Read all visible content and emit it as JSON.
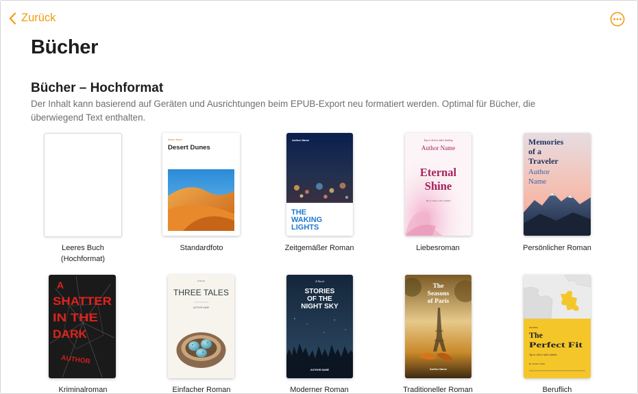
{
  "nav": {
    "back_label": "Zurück",
    "more_icon": "ellipsis-circle-icon",
    "accent": "#f29a12"
  },
  "page_title": "Bücher",
  "section": {
    "title": "Bücher – Hochformat",
    "description": "Der Inhalt kann basierend auf Geräten und Ausrichtungen beim EPUB-Export neu formatiert werden. Optimal für Bücher, die überwiegend Text enthalten."
  },
  "templates": [
    {
      "label": "Leeres Buch\n(Hochformat)",
      "cover": {}
    },
    {
      "label": "Standardfoto",
      "cover": {
        "author": "Author Name",
        "title": "Desert Dunes"
      }
    },
    {
      "label": "Zeitgemäßer Roman",
      "cover": {
        "author": "Author Name",
        "title_lines": [
          "THE",
          "WAKING",
          "LIGHTS"
        ]
      }
    },
    {
      "label": "Liebesroman",
      "cover": {
        "heading_hint": "Tap or click to add a heading",
        "author": "Author Name",
        "title_lines": [
          "Eternal",
          "Shine"
        ],
        "subtitle_hint": "Tap or click to add a subtitle"
      }
    },
    {
      "label": "Persönlicher Roman",
      "cover": {
        "title_lines": [
          "Memories",
          "of a",
          "Traveler"
        ],
        "author_lines": [
          "Author",
          "Name"
        ]
      }
    },
    {
      "label": "Kriminalroman",
      "cover": {
        "title_lines": [
          "A",
          "SHATTER",
          "IN THE",
          "DARK"
        ],
        "author": "AUTHOR"
      }
    },
    {
      "label": "Einfacher Roman",
      "cover": {
        "kicker": "A Novel",
        "title": "THREE TALES",
        "author": "AUTHOR NAME"
      }
    },
    {
      "label": "Moderner Roman",
      "cover": {
        "kicker": "A Novel",
        "title_lines": [
          "STORIES",
          "OF THE",
          "NIGHT SKY"
        ],
        "author": "AUTHOR NAME"
      }
    },
    {
      "label": "Traditioneller Roman",
      "cover": {
        "title_lines": [
          "The",
          "Seasons",
          "of Paris"
        ],
        "author": "Author Name"
      }
    },
    {
      "label": "Beruflich",
      "cover": {
        "kicker": "HEADING",
        "title_lines": [
          "The",
          "Perfect Fit"
        ],
        "subtitle_hint": "Tap or click to add a subtitle",
        "author": "By Author Name"
      }
    }
  ]
}
